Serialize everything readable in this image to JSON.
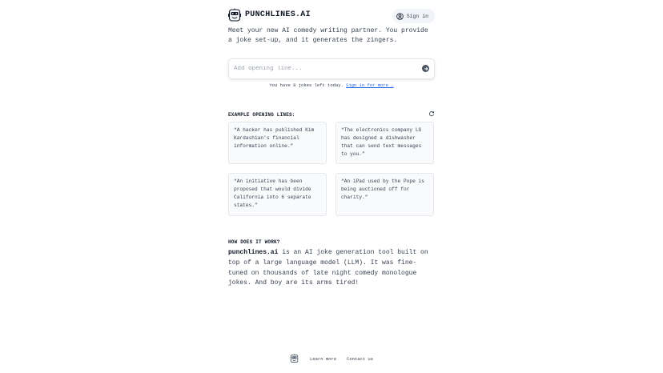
{
  "header": {
    "brand": "PUNCHLINES.AI",
    "logo_icon": "robot-face-icon",
    "signin_label": "Sign in",
    "signin_icon": "user-circle-icon"
  },
  "intro": "Meet your new AI comedy writing partner. You provide a joke set-up, and it generates the zingers.",
  "input": {
    "placeholder": "Add opening line...",
    "value": "",
    "submit_icon": "arrow-right-circle-icon"
  },
  "quota": {
    "text": "You have 8 jokes left today.",
    "link": "Sign in for more →"
  },
  "examples": {
    "title": "EXAMPLE OPENING LINES:",
    "refresh_icon": "refresh-icon",
    "items": [
      "“A hacker has published Kim Kardashian's financial information online.”",
      "“The electronics company LG has designed a dishwasher that can send text messages to you.”",
      "“An initiative has been proposed that would divide California into 6 separate states.”",
      "“An iPad used by the Pope is being auctioned off for charity.”"
    ]
  },
  "how": {
    "title": "HOW DOES IT WORK?",
    "brand": "punchlines.ai",
    "text": " is an AI joke generation tool built on top of a large language model (LLM). It was fine-tuned on thousands of late night comedy monologue jokes. And boy are its arms tired!"
  },
  "footer": {
    "logo_icon": "robot-face-icon",
    "learn_more": "Learn more",
    "contact": "Contact us"
  },
  "colors": {
    "link": "#2563eb",
    "card_bg": "#f9fafb",
    "signin_bg": "#f1f4f8"
  }
}
